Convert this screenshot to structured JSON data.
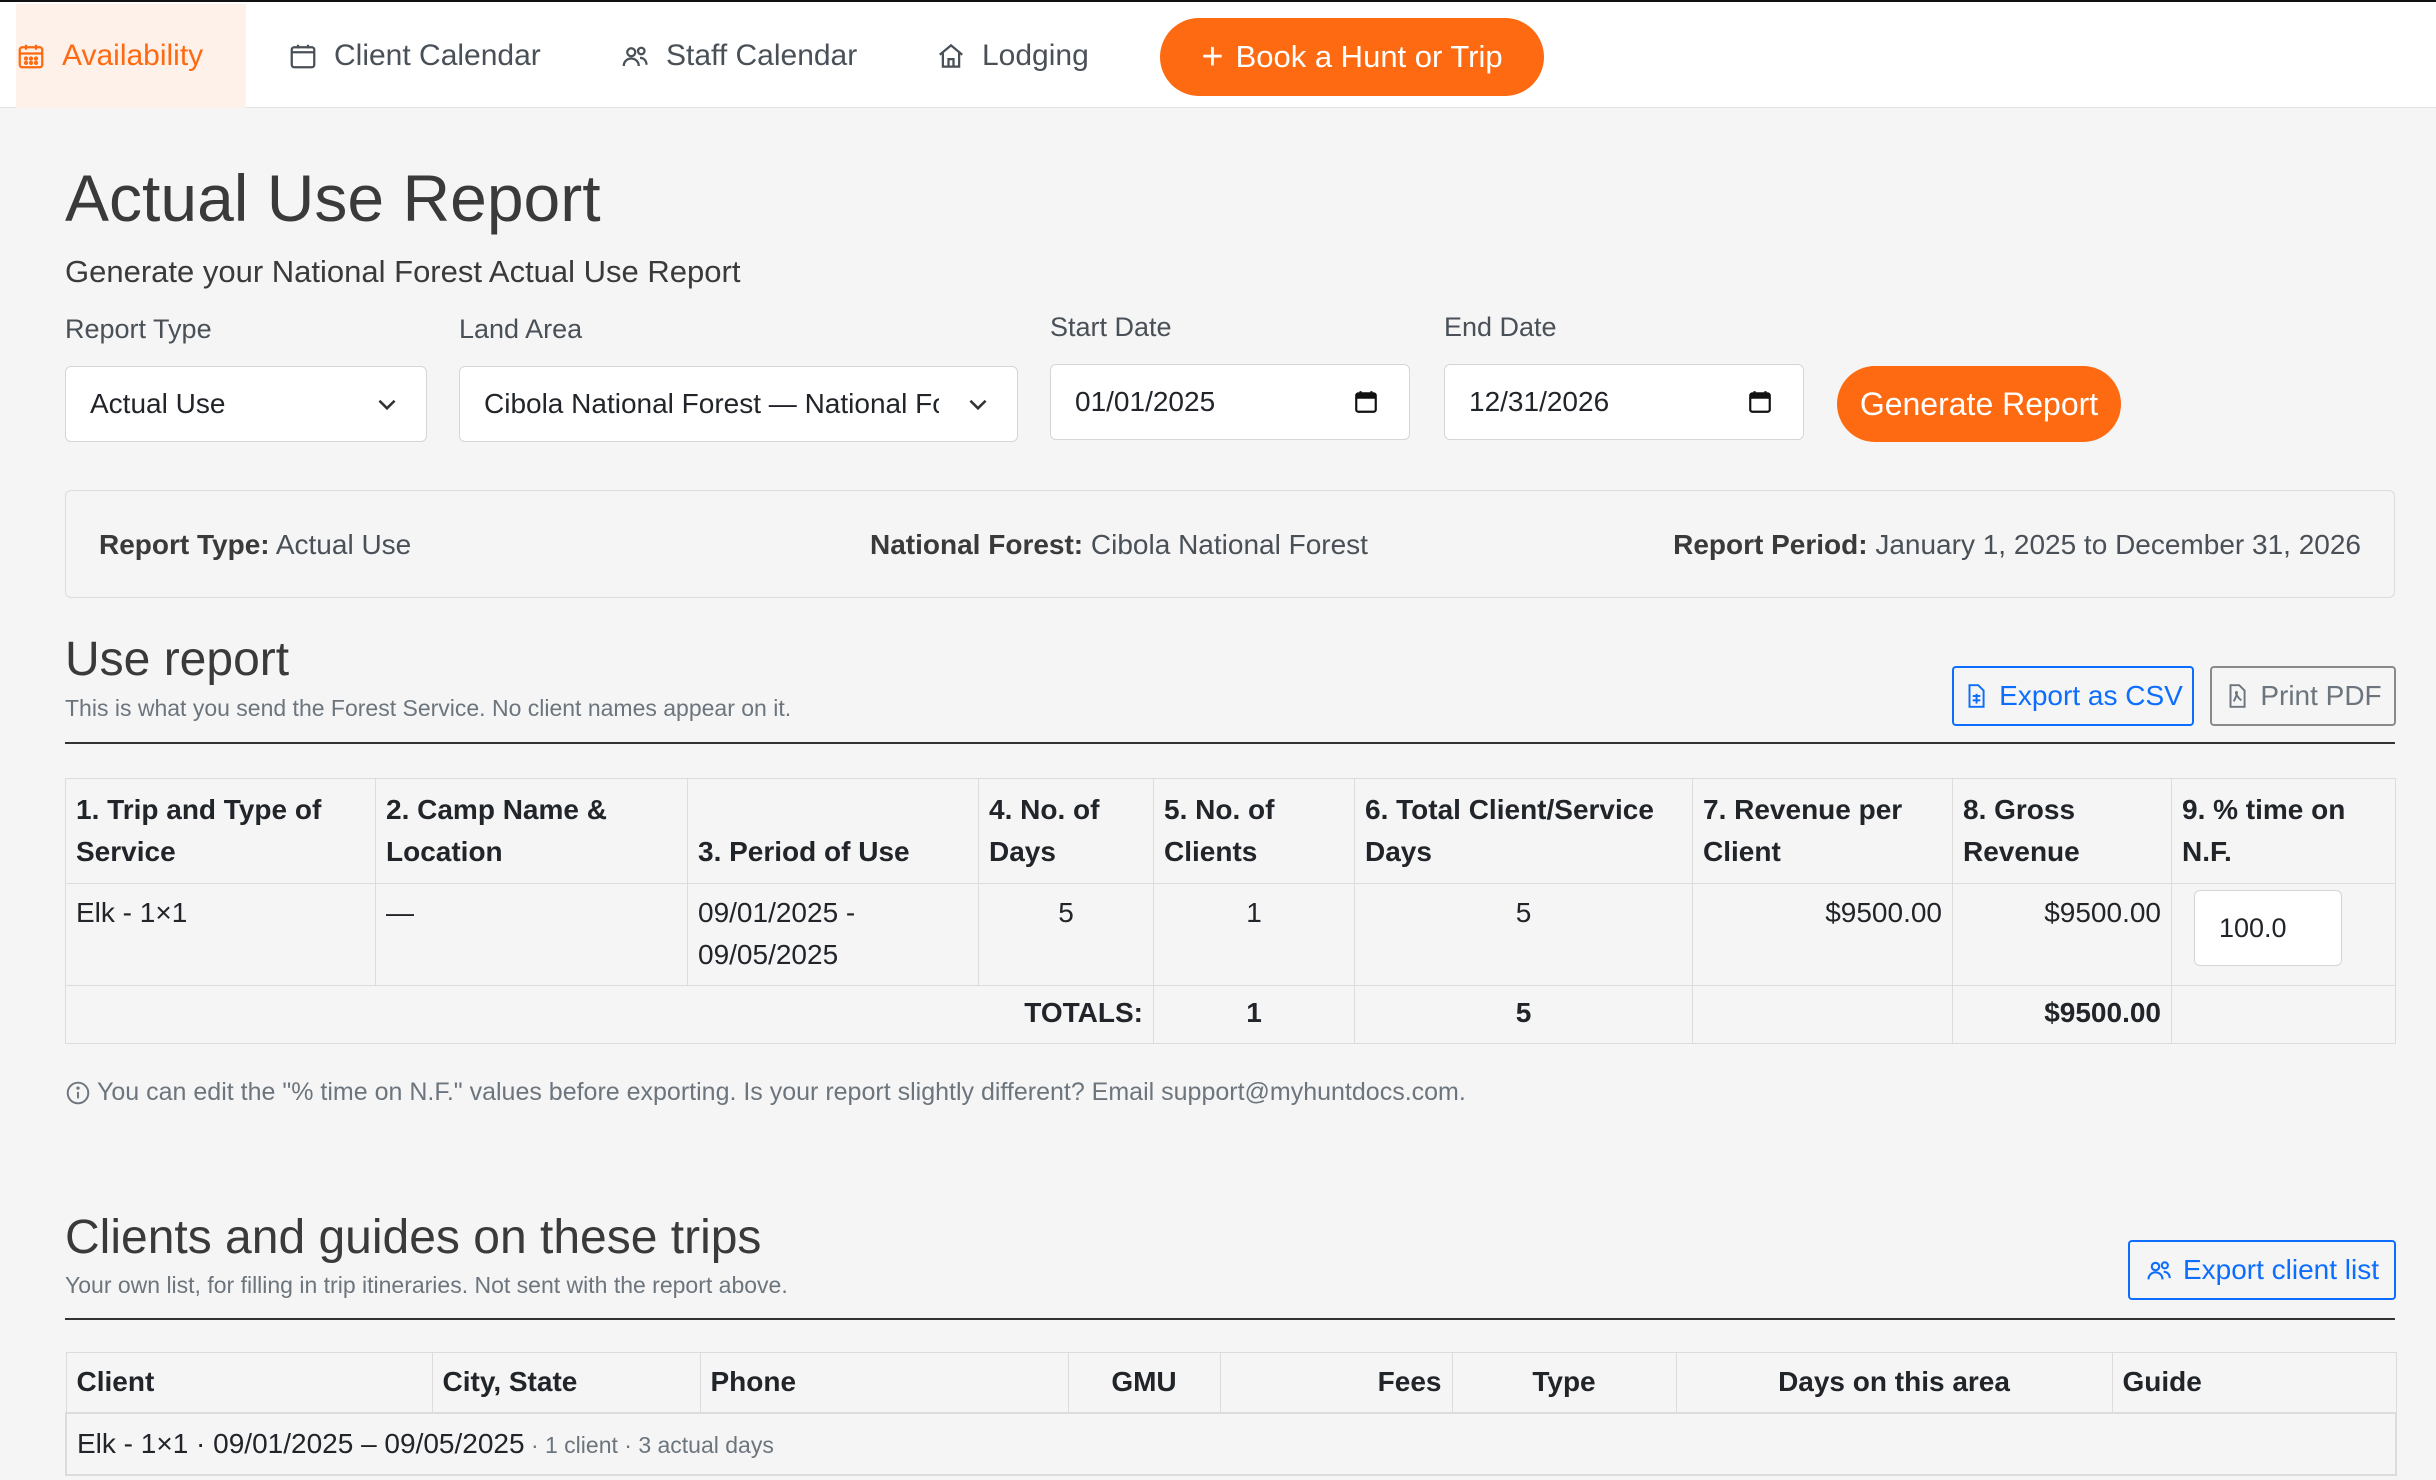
{
  "nav": {
    "items": [
      {
        "label": "Availability",
        "icon": "calendar-grid-icon"
      },
      {
        "label": "Client Calendar",
        "icon": "calendar-icon"
      },
      {
        "label": "Staff Calendar",
        "icon": "people-icon"
      },
      {
        "label": "Lodging",
        "icon": "house-icon"
      }
    ],
    "book_label": "Book a Hunt or Trip"
  },
  "header": {
    "title": "Actual Use Report",
    "subtitle": "Generate your National Forest Actual Use Report"
  },
  "form": {
    "report_type": {
      "label": "Report Type",
      "value": "Actual Use"
    },
    "land_area": {
      "label": "Land Area",
      "value": "Cibola National Forest — National Forest"
    },
    "start_date": {
      "label": "Start Date",
      "value": "01/01/2025"
    },
    "end_date": {
      "label": "End Date",
      "value": "12/31/2026"
    },
    "generate_label": "Generate Report"
  },
  "summary": {
    "report_type_label": "Report Type:",
    "report_type_value": "Actual Use",
    "forest_label": "National Forest:",
    "forest_value": "Cibola National Forest",
    "period_label": "Report Period:",
    "period_value": "January 1, 2025 to December 31, 2026"
  },
  "use_report": {
    "title": "Use report",
    "subtitle": "This is what you send the Forest Service. No client names appear on it.",
    "export_csv_label": "Export as CSV",
    "print_pdf_label": "Print PDF",
    "columns": [
      "1. Trip and Type of Service",
      "2. Camp Name & Location",
      "3. Period of Use",
      "4. No. of Days",
      "5. No. of Clients",
      "6. Total Client/Service Days",
      "7. Revenue per Client",
      "8. Gross Revenue",
      "9. % time on N.F."
    ],
    "rows": [
      {
        "trip": "Elk - 1×1",
        "camp": "—",
        "period": "09/01/2025 - 09/05/2025",
        "days": "5",
        "clients": "1",
        "service_days": "5",
        "revenue_per_client": "$9500.00",
        "gross_revenue": "$9500.00",
        "pct_time": "100.0"
      }
    ],
    "totals": {
      "label": "TOTALS:",
      "clients": "1",
      "service_days": "5",
      "gross_revenue": "$9500.00"
    },
    "note": "You can edit the \"% time on N.F.\" values before exporting. Is your report slightly different? Email support@myhuntdocs.com."
  },
  "clients_section": {
    "title": "Clients and guides on these trips",
    "subtitle": "Your own list, for filling in trip itineraries. Not sent with the report above.",
    "export_label": "Export client list",
    "columns": [
      "Client",
      "City, State",
      "Phone",
      "GMU",
      "Fees",
      "Type",
      "Days on this area",
      "Guide"
    ],
    "groups": [
      {
        "label": "Elk - 1×1 · 09/01/2025 – 09/05/2025",
        "meta": " · 1 client · 3 actual days"
      }
    ]
  },
  "colors": {
    "accent": "#fd6a11",
    "link": "#0d6efd"
  }
}
